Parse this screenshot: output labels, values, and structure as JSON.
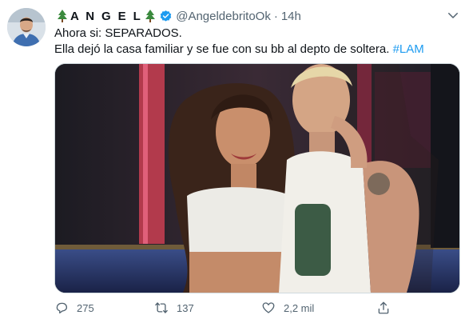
{
  "tweet": {
    "author_name": "A N G E L",
    "handle": "@AngeldebritoOk",
    "separator": "·",
    "time": "14h",
    "text_line1": "Ahora si: SEPARADOS.",
    "text_line2": "Ella dejó la casa familiar y se fue con su bb al depto de soltera.",
    "hashtag": "#LAM",
    "accent_color": "#1d9bf0"
  },
  "actions": {
    "reply_count": "275",
    "retweet_count": "137",
    "like_count": "2,2 mil"
  },
  "icons": [
    "tree-icon",
    "verified-badge-icon",
    "chevron-down-icon",
    "reply-icon",
    "retweet-icon",
    "like-icon",
    "share-icon"
  ]
}
